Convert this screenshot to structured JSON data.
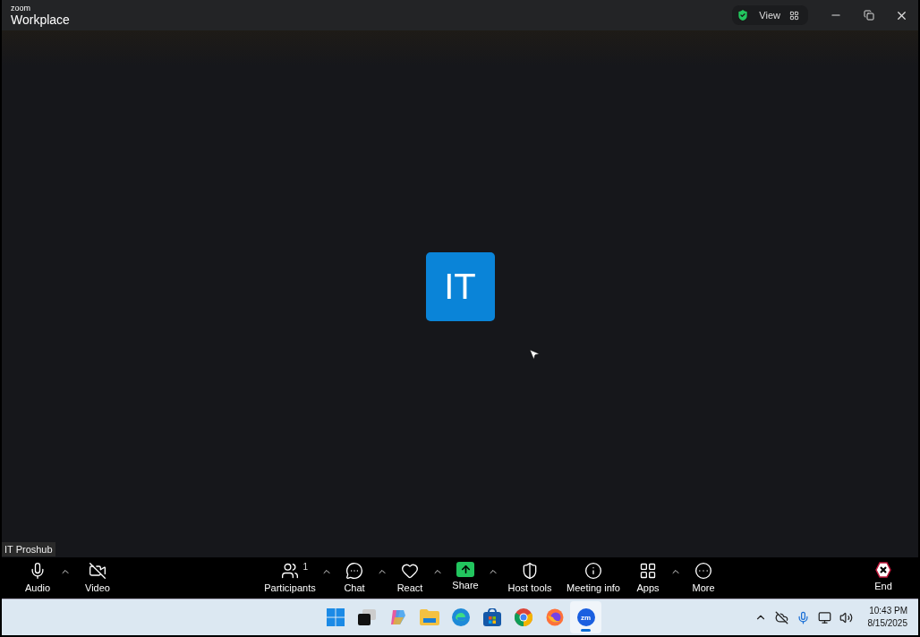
{
  "window": {
    "brand": "zoom",
    "title": "Workplace",
    "view_label": "View"
  },
  "meeting": {
    "avatar_initials": "IT",
    "name_tag": "IT Proshub"
  },
  "toolbar": [
    {
      "kind": "audio",
      "label": "Audio",
      "on": true,
      "caret": true
    },
    {
      "kind": "video",
      "label": "Video",
      "on": false,
      "caret": false
    },
    {
      "kind": "participants",
      "label": "Participants",
      "count": "1",
      "caret": true
    },
    {
      "kind": "chat",
      "label": "Chat",
      "caret": true
    },
    {
      "kind": "react",
      "label": "React",
      "caret": true
    },
    {
      "kind": "share",
      "label": "Share",
      "caret": true
    },
    {
      "kind": "host",
      "label": "Host tools",
      "caret": false
    },
    {
      "kind": "info",
      "label": "Meeting info",
      "caret": false
    },
    {
      "kind": "apps",
      "label": "Apps",
      "caret": true
    },
    {
      "kind": "more",
      "label": "More",
      "caret": false
    }
  ],
  "end_button": {
    "label": "End"
  },
  "taskbar": {
    "apps": [
      {
        "kind": "start",
        "selected": false
      },
      {
        "kind": "taskview",
        "selected": false
      },
      {
        "kind": "copilot",
        "selected": false
      },
      {
        "kind": "files",
        "selected": false
      },
      {
        "kind": "edge",
        "selected": false
      },
      {
        "kind": "store",
        "selected": false
      },
      {
        "kind": "chrome",
        "selected": false
      },
      {
        "kind": "firefox",
        "selected": false
      },
      {
        "kind": "zoom",
        "selected": true,
        "label": "zm"
      }
    ],
    "time": "10:43 PM",
    "date": "8/15/2025"
  }
}
